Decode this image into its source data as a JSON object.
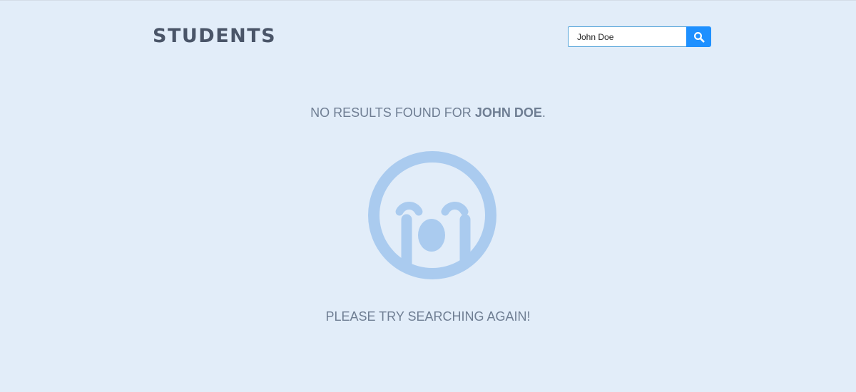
{
  "header": {
    "title": "STUDENTS"
  },
  "search": {
    "value": "John Doe",
    "button_icon": "search-icon",
    "button_color": "#1e90ff"
  },
  "results": {
    "prefix": "NO RESULTS FOUND FOR ",
    "query": "JOHN DOE",
    "suffix": ".",
    "illustration_icon": "crying-face-icon",
    "illustration_color": "#aacbef",
    "hint": "PLEASE TRY SEARCHING AGAIN!"
  },
  "colors": {
    "background": "#e2edf9",
    "title": "#4a5568",
    "message_text": "#6f7e93"
  }
}
